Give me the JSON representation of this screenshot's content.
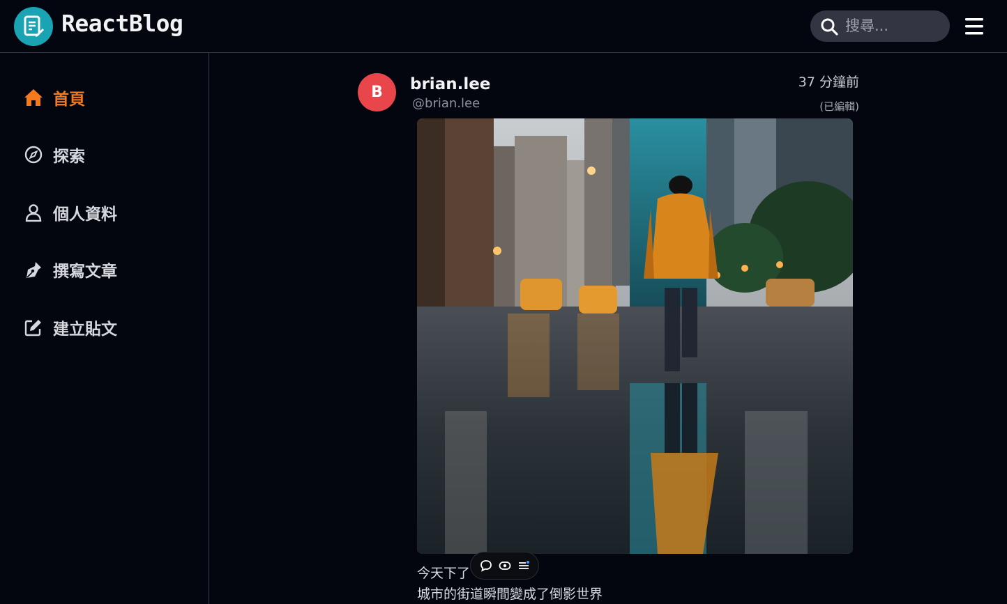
{
  "header": {
    "brand": "ReactBlog",
    "search_placeholder": "搜尋..."
  },
  "sidebar": {
    "items": [
      {
        "label": "首頁",
        "icon": "home-icon",
        "active": true
      },
      {
        "label": "探索",
        "icon": "compass-icon",
        "active": false
      },
      {
        "label": "個人資料",
        "icon": "user-icon",
        "active": false
      },
      {
        "label": "撰寫文章",
        "icon": "pen-nib-icon",
        "active": false
      },
      {
        "label": "建立貼文",
        "icon": "edit-icon",
        "active": false
      }
    ]
  },
  "post": {
    "avatar_letter": "B",
    "username": "brian.lee",
    "handle": "@brian.lee",
    "time": "37 分鐘前",
    "edited": "(已編輯)",
    "caption_line1": "今天下了",
    "caption_line2": "城市的街道瞬間變成了倒影世界",
    "actions": [
      "comment-icon",
      "view-icon",
      "list-icon"
    ]
  },
  "colors": {
    "background": "#03050f",
    "accent": "#f47a1c",
    "logo": "#1aa3b3",
    "avatar": "#e8464a"
  }
}
